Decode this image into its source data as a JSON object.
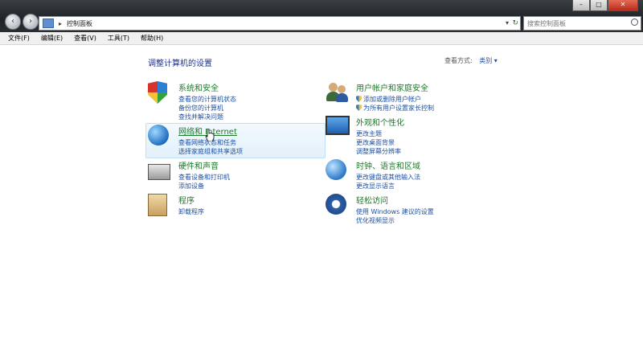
{
  "address_bar": {
    "breadcrumb": "控制面板",
    "separator": "▸"
  },
  "search": {
    "placeholder": "搜索控制面板"
  },
  "window_controls": {
    "minimize": "–",
    "maximize": "□",
    "close": "✕"
  },
  "menu": [
    "文件(F)",
    "编辑(E)",
    "查看(V)",
    "工具(T)",
    "帮助(H)"
  ],
  "page": {
    "heading": "调整计算机的设置",
    "view_by_label": "查看方式:",
    "view_by_value": "类别 ▾"
  },
  "categories": [
    {
      "title": "系统和安全",
      "links": [
        "查看您的计算机状态",
        "备份您的计算机",
        "查找并解决问题"
      ],
      "icon": "shield-icon"
    },
    {
      "title": "网络和 Internet",
      "links": [
        "查看网络状态和任务",
        "选择家庭组和共享选项"
      ],
      "icon": "network-globe-icon"
    },
    {
      "title": "硬件和声音",
      "links": [
        "查看设备和打印机",
        "添加设备"
      ],
      "icon": "printer-icon"
    },
    {
      "title": "程序",
      "links": [
        "卸载程序"
      ],
      "icon": "programs-box-icon"
    },
    {
      "title": "用户帐户和家庭安全",
      "links": [
        "添加或删除用户帐户",
        "为所有用户设置家长控制"
      ],
      "icon": "users-icon"
    },
    {
      "title": "外观和个性化",
      "links": [
        "更改主题",
        "更改桌面背景",
        "调整屏幕分辨率"
      ],
      "icon": "monitor-icon"
    },
    {
      "title": "时钟、语言和区域",
      "links": [
        "更改键盘或其他输入法",
        "更改显示语言"
      ],
      "icon": "clock-globe-icon"
    },
    {
      "title": "轻松访问",
      "links": [
        "使用 Windows 建议的设置",
        "优化视频显示"
      ],
      "icon": "accessibility-icon"
    }
  ]
}
